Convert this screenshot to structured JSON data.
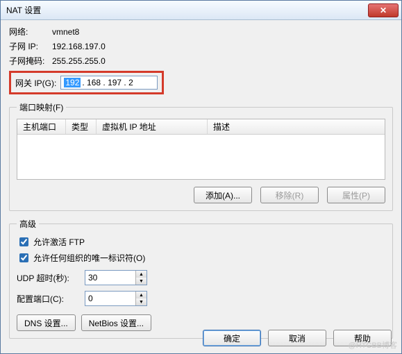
{
  "title": "NAT 设置",
  "network": {
    "label": "网络:",
    "value": "vmnet8"
  },
  "subnet_ip": {
    "label": "子网 IP:",
    "value": "192.168.197.0"
  },
  "subnet_mask": {
    "label": "子网掩码:",
    "value": "255.255.255.0"
  },
  "gateway": {
    "label": "网关 IP(G):",
    "selected": "192",
    "rest": ". 168 . 197 .   2"
  },
  "port_forward": {
    "legend": "端口映射(F)",
    "cols": {
      "host": "主机端口",
      "type": "类型",
      "vm_ip": "虚拟机 IP 地址",
      "desc": "描述"
    },
    "buttons": {
      "add": "添加(A)...",
      "remove": "移除(R)",
      "props": "属性(P)"
    }
  },
  "advanced": {
    "legend": "高级",
    "ftp": "允许激活 FTP",
    "oui": "允许任何组织的唯一标识符(O)",
    "udp_label": "UDP 超时(秒):",
    "udp_value": "30",
    "port_label": "配置端口(C):",
    "port_value": "0",
    "dns_btn": "DNS 设置...",
    "netbios_btn": "NetBios 设置..."
  },
  "footer": {
    "ok": "确定",
    "cancel": "取消",
    "help": "帮助"
  },
  "watermark": "@HTCBB博客"
}
